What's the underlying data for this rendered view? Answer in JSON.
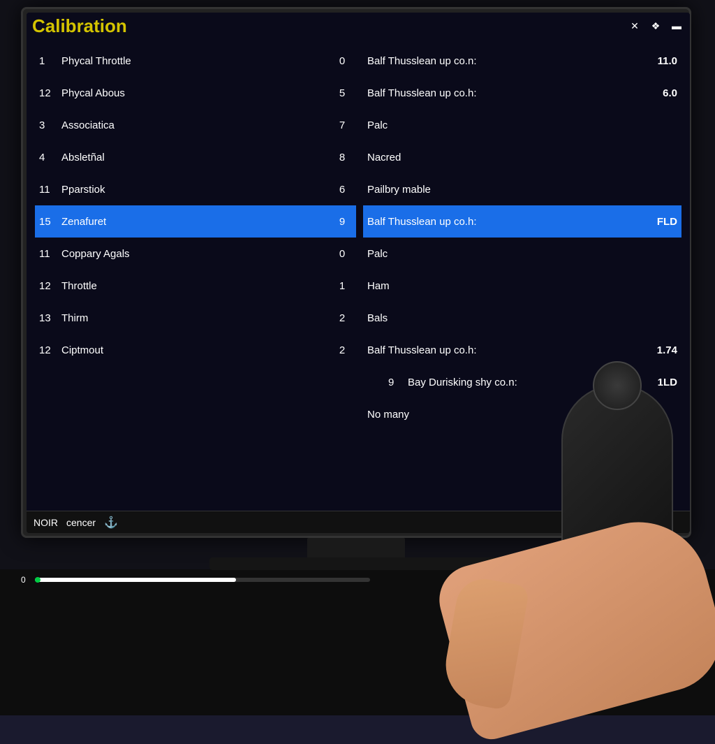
{
  "window": {
    "title": "Calibration",
    "controls": [
      "✕",
      "❖",
      "▬"
    ]
  },
  "left_rows": [
    {
      "num": "1",
      "name": "Phycal Throttle",
      "val": "0"
    },
    {
      "num": "12",
      "name": "Phycal Abous",
      "val": "5"
    },
    {
      "num": "3",
      "name": "Associatica",
      "val": "7"
    },
    {
      "num": "4",
      "name": "Absletñal",
      "val": "8"
    },
    {
      "num": "11",
      "name": "Pparstiok",
      "val": "6"
    },
    {
      "num": "15",
      "name": "Zenafuret",
      "val": "9",
      "selected": true
    },
    {
      "num": "11",
      "name": "Coppary Agals",
      "val": "0"
    },
    {
      "num": "12",
      "name": "Throttle",
      "val": "1"
    },
    {
      "num": "13",
      "name": "Thirm",
      "val": "2"
    },
    {
      "num": "12",
      "name": "Ciptmout",
      "val": "2"
    }
  ],
  "right_rows": [
    {
      "val": "",
      "name": "Balf Thusslean up co.n:",
      "extra": "11.0"
    },
    {
      "val": "",
      "name": "Balf Thusslean up co.h:",
      "extra": "6.0"
    },
    {
      "val": "",
      "name": "Palc",
      "extra": ""
    },
    {
      "val": "",
      "name": "Nacred",
      "extra": ""
    },
    {
      "val": "",
      "name": "Pailbry mable",
      "extra": ""
    },
    {
      "val": "",
      "name": "Balf Thusslean up co.h:",
      "extra": "FLD",
      "selected": true
    },
    {
      "val": "",
      "name": "Palc",
      "extra": ""
    },
    {
      "val": "",
      "name": "Ham",
      "extra": ""
    },
    {
      "val": "",
      "name": "Bals",
      "extra": ""
    },
    {
      "val": "",
      "name": "Balf Thusslean up co.h:",
      "extra": "1.74"
    }
  ],
  "extra_right_rows": [
    {
      "val": "9",
      "name": "Bay Durisking shy co.n:",
      "extra": "1LD"
    },
    {
      "val": "",
      "name": "No many",
      "extra": ""
    }
  ],
  "status_bar": {
    "text1": "NOIR",
    "text2": "cencer",
    "icon": "⚓"
  },
  "progress": {
    "label": "0"
  }
}
